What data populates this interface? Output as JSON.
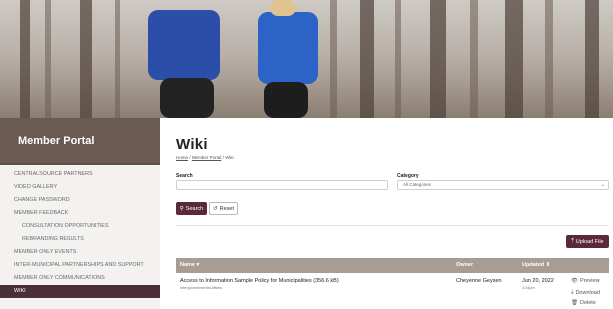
{
  "sidebar": {
    "title": "Member Portal",
    "items": [
      {
        "label": "CENTRALSOURCE PARTNERS"
      },
      {
        "label": "VIDEO GALLERY"
      },
      {
        "label": "CHANGE PASSWORD"
      },
      {
        "label": "MEMBER FEEDBACK"
      },
      {
        "label": "CONSULTATION OPPORTUNITIES"
      },
      {
        "label": "REBRANDING RESULTS"
      },
      {
        "label": "MEMBER ONLY EVENTS"
      },
      {
        "label": "INTER-MUNICIPAL PARTNERSHIPS AND SUPPORT"
      },
      {
        "label": "MEMBER ONLY COMMUNICATIONS"
      },
      {
        "label": "WIKI"
      }
    ]
  },
  "page": {
    "title": "Wiki",
    "breadcrumb": {
      "home": "Home",
      "sep1": "/",
      "portal": "Member Portal",
      "sep2": "/",
      "current": "Wiki"
    }
  },
  "search": {
    "label": "Search",
    "value": "",
    "category_label": "Category",
    "category_value": "All Categories",
    "search_button": "Search",
    "reset_button": "Reset",
    "upload_button": "Upload File"
  },
  "table": {
    "headers": {
      "name": "Name",
      "owner": "Owner",
      "updated": "Updated"
    },
    "rows": [
      {
        "name": "Access to Information Sample Policy for Municipalities (356.6 kB)",
        "category": "Intergovernmental Affairs",
        "owner": "Cheyenne Geysen",
        "date": "Jun 20, 2022",
        "time": "3:34pm",
        "actions": {
          "preview": "Preview",
          "download": "Download",
          "delete": "Delete"
        }
      }
    ]
  },
  "colors": {
    "brand": "#5a2a39",
    "sidebar_header": "#6a5a52",
    "table_header": "#a89c93"
  }
}
